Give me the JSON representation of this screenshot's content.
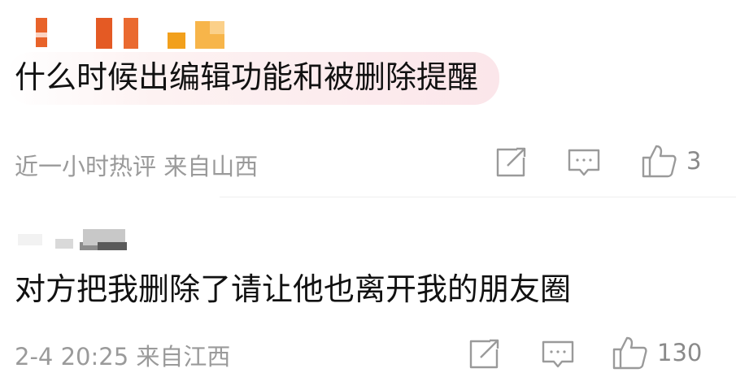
{
  "comments": [
    {
      "text": "什么时候出编辑功能和被删除提醒",
      "meta": "近一小时热评  来自山西",
      "like_count": "3",
      "icons": [
        "share-icon",
        "comment-icon",
        "like-icon"
      ]
    },
    {
      "text": "对方把我删除了请让他也离开我的朋友圈",
      "meta": "2-4 20:25  来自江西",
      "like_count": "130",
      "icons": [
        "share-icon",
        "comment-icon",
        "like-icon"
      ]
    }
  ],
  "colors": {
    "text": "#111111",
    "meta": "#9a9a9a",
    "highlight": "#fbe6ea",
    "avatar_redaction": "#e8632a"
  }
}
